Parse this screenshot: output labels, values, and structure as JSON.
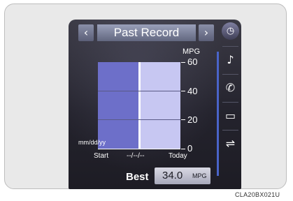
{
  "header": {
    "prev_icon": "◀",
    "title": "Past Record",
    "next_icon": "▶"
  },
  "chart": {
    "units_label": "MPG",
    "date_format_label": "mm/dd/yy",
    "y_ticks": [
      "60",
      "40",
      "20",
      "0"
    ],
    "x_labels": [
      "Start",
      "--/--/--",
      "Today"
    ]
  },
  "chart_data": {
    "type": "bar",
    "categories": [
      "Start",
      "Today"
    ],
    "values": [
      60,
      60
    ],
    "ylabel": "MPG",
    "ylim": [
      0,
      60
    ],
    "colors": [
      "#6d6fc9",
      "#c7c7f2"
    ],
    "grid": true
  },
  "best": {
    "label": "Best",
    "value": "34.0",
    "unit": "MPG"
  },
  "sidebar": {
    "items": [
      {
        "icon": "speedometer-icon",
        "glyph": "◷"
      },
      {
        "icon": "music-note-icon",
        "glyph": "♪"
      },
      {
        "icon": "phone-icon",
        "glyph": "✆"
      },
      {
        "icon": "car-info-icon",
        "glyph": "▭"
      },
      {
        "icon": "road-icon",
        "glyph": "⇌"
      }
    ]
  },
  "caption": "CLA20BX021U"
}
